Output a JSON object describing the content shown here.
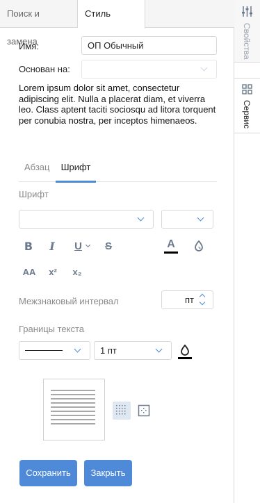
{
  "top_tabs": {
    "search_replace": "Поиск и замена",
    "paragraph_style": "Стиль абзаца"
  },
  "form": {
    "name_label": "Имя:",
    "name_value": "ОП Обычный",
    "based_on_label": "Основан на:",
    "based_on_value": ""
  },
  "preview_text": "Lorem ipsum dolor sit amet, consectetur adipiscing elit. Nulla a placerat diam, et viverra leo. Class aptent taciti sociosqu ad litora torquent per conubia nostra, per inceptos himenaeos.",
  "sub_tabs": {
    "paragraph": "Абзац",
    "font": "Шрифт"
  },
  "font_section": {
    "title": "Шрифт",
    "font_family_value": "",
    "font_size_value": "",
    "glyphs": {
      "bold": "B",
      "italic": "I",
      "underline": "U",
      "strike": "S",
      "font_color": "A",
      "all_caps": "AA",
      "superscript": "x²",
      "subscript": "x₂"
    },
    "spacing_label": "Межзнаковый интервал",
    "spacing_unit": "пт",
    "borders_label": "Границы текста",
    "border_width_value": "1 пт"
  },
  "actions": {
    "save": "Сохранить",
    "close": "Закрыть"
  },
  "rail": {
    "properties": "Свойства",
    "service": "Сервис"
  },
  "colors": {
    "accent": "#4a8bd8",
    "button": "#4f8ad8",
    "icon": "#6b7a8c",
    "muted_text": "#8a8a8a"
  }
}
